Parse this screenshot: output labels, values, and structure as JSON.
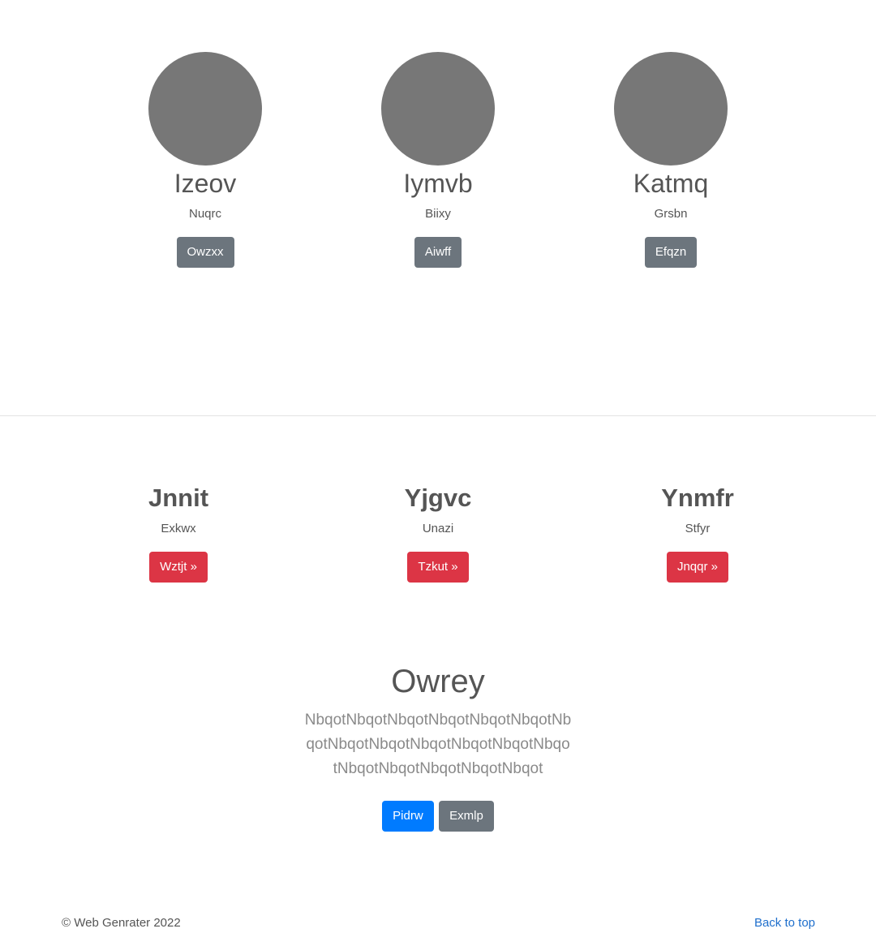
{
  "profiles": [
    {
      "name": "Izeov",
      "subtitle": "Nuqrc",
      "button": "Owzxx"
    },
    {
      "name": "Iymvb",
      "subtitle": "Biixy",
      "button": "Aiwff"
    },
    {
      "name": "Katmq",
      "subtitle": "Grsbn",
      "button": "Efqzn"
    }
  ],
  "features": [
    {
      "title": "Jnnit",
      "subtitle": "Exkwx",
      "button": "Wztjt »"
    },
    {
      "title": "Yjgvc",
      "subtitle": "Unazi",
      "button": "Tzkut »"
    },
    {
      "title": "Ynmfr",
      "subtitle": "Stfyr",
      "button": "Jnqqr »"
    }
  ],
  "hero": {
    "title": "Owrey",
    "text": "NbqotNbqotNbqotNbqotNbqotNbqotNbqotNbqotNbqotNbqotNbqotNbqotNbqotNbqotNbqotNbqotNbqotNbqot",
    "primary_button": "Pidrw",
    "secondary_button": "Exmlp"
  },
  "footer": {
    "copyright": "© Web Genrater 2022",
    "back_to_top": "Back to top"
  },
  "colors": {
    "avatar": "#777777",
    "secondary": "#6c757d",
    "danger": "#dc3545",
    "primary": "#007bff",
    "link": "#1f6fcc"
  }
}
